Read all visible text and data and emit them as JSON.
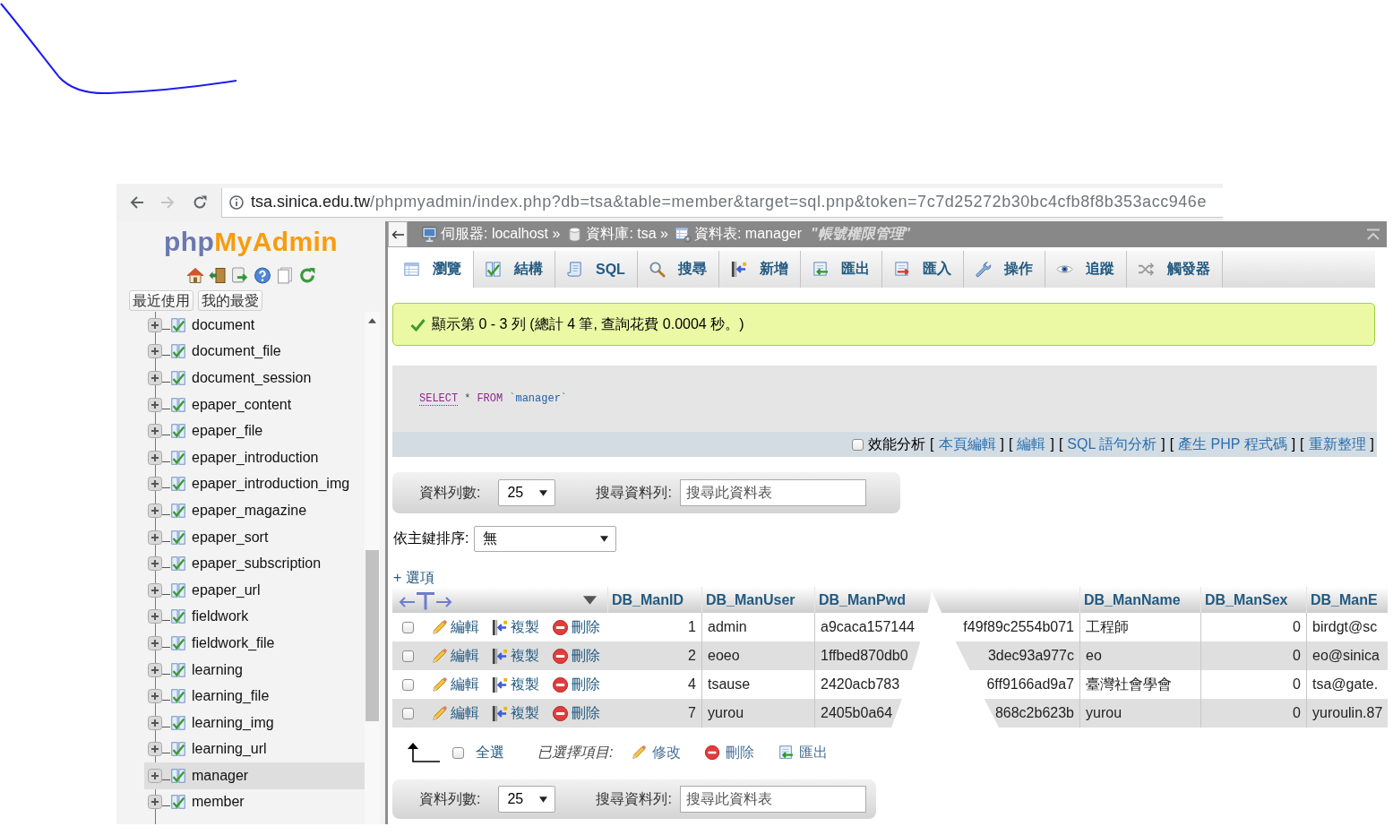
{
  "browser": {
    "url_host": "tsa.sinica.edu.tw",
    "url_path": "/phpmyadmin/index.php?db=tsa&table=member&target=sql.pnp&token=7c7d25272b30bc4cfb8f8b353acc946e"
  },
  "sidebar": {
    "logo": {
      "prefix": "php",
      "name": "MyAdmin"
    },
    "tabs": [
      {
        "label": "最近使用"
      },
      {
        "label": "我的最愛"
      }
    ],
    "tables": [
      {
        "name": "document",
        "expanded": false,
        "selected": false
      },
      {
        "name": "document_file",
        "expanded": false,
        "selected": false
      },
      {
        "name": "document_session",
        "expanded": false,
        "selected": false
      },
      {
        "name": "epaper_content",
        "expanded": false,
        "selected": false
      },
      {
        "name": "epaper_file",
        "expanded": false,
        "selected": false
      },
      {
        "name": "epaper_introduction",
        "expanded": false,
        "selected": false
      },
      {
        "name": "epaper_introduction_img",
        "expanded": false,
        "selected": false
      },
      {
        "name": "epaper_magazine",
        "expanded": false,
        "selected": false
      },
      {
        "name": "epaper_sort",
        "expanded": false,
        "selected": false
      },
      {
        "name": "epaper_subscription",
        "expanded": false,
        "selected": false
      },
      {
        "name": "epaper_url",
        "expanded": false,
        "selected": false
      },
      {
        "name": "fieldwork",
        "expanded": false,
        "selected": false
      },
      {
        "name": "fieldwork_file",
        "expanded": false,
        "selected": false
      },
      {
        "name": "learning",
        "expanded": false,
        "selected": false
      },
      {
        "name": "learning_file",
        "expanded": false,
        "selected": false
      },
      {
        "name": "learning_img",
        "expanded": false,
        "selected": false
      },
      {
        "name": "learning_url",
        "expanded": false,
        "selected": false
      },
      {
        "name": "manager",
        "expanded": false,
        "selected": true
      },
      {
        "name": "member",
        "expanded": false,
        "selected": false
      }
    ]
  },
  "breadcrumb": {
    "items": [
      {
        "kind": "server",
        "label": "伺服器: localhost »"
      },
      {
        "kind": "database",
        "label": "資料庫: tsa »"
      },
      {
        "kind": "table",
        "label": "資料表: manager"
      }
    ],
    "comment": "\"帳號權限管理\""
  },
  "tabs": [
    {
      "kind": "browse",
      "label": "瀏覽",
      "selected": true
    },
    {
      "kind": "structure",
      "label": "結構",
      "selected": false
    },
    {
      "kind": "sql",
      "label": "SQL",
      "selected": false
    },
    {
      "kind": "search",
      "label": "搜尋",
      "selected": false
    },
    {
      "kind": "insert",
      "label": "新增",
      "selected": false
    },
    {
      "kind": "export",
      "label": "匯出",
      "selected": false
    },
    {
      "kind": "import",
      "label": "匯入",
      "selected": false
    },
    {
      "kind": "operations",
      "label": "操作",
      "selected": false
    },
    {
      "kind": "tracking",
      "label": "追蹤",
      "selected": false
    },
    {
      "kind": "triggers",
      "label": "觸發器",
      "selected": false
    }
  ],
  "message": {
    "text": "顯示第 0 - 3 列 (總計 4 筆, 查詢花費 0.0004 秒。)"
  },
  "query": {
    "tokens": [
      {
        "kind": "keyword_link",
        "text": "SELECT"
      },
      {
        "kind": "operator",
        "text": "*"
      },
      {
        "kind": "keyword",
        "text": "FROM"
      },
      {
        "kind": "identifier",
        "text": "`manager`"
      }
    ],
    "profiling": {
      "label": "效能分析",
      "checked": false
    },
    "links": [
      {
        "open": "[",
        "label": "本頁編輯",
        "close": "]"
      },
      {
        "open": "[",
        "label": "編輯",
        "close": "]"
      },
      {
        "open": "[",
        "label": "SQL 語句分析",
        "close": "]"
      },
      {
        "open": "[",
        "label": "產生 PHP 程式碼",
        "close": "]"
      },
      {
        "open": "[",
        "label": "重新整理",
        "close": "]"
      }
    ]
  },
  "navigation_top": {
    "rows_label": "資料列數:",
    "rows_value": "25",
    "search_label": "搜尋資料列:",
    "search_placeholder": "搜尋此資料表"
  },
  "sort": {
    "label": "依主鍵排序:",
    "value": "無"
  },
  "options_link": {
    "label": "+ 選項"
  },
  "table": {
    "columns": [
      {
        "label": "DB_ManID",
        "kind": "number"
      },
      {
        "label": "DB_ManUser",
        "kind": "text"
      },
      {
        "label": "DB_ManPwd",
        "kind": "torn"
      },
      {
        "label": "DB_ManName",
        "kind": "text"
      },
      {
        "label": "DB_ManSex",
        "kind": "number"
      },
      {
        "label": "DB_ManE",
        "kind": "text"
      }
    ],
    "rows": [
      {
        "checked": false,
        "actions": [
          {
            "kind": "edit",
            "label": "編輯"
          },
          {
            "kind": "copy",
            "label": "複製"
          },
          {
            "kind": "delete",
            "label": "刪除"
          }
        ],
        "cells": [
          {
            "text": "1"
          },
          {
            "text": "admin"
          },
          {
            "start": "a9caca157144",
            "end": "f49f89c2554b071"
          },
          {
            "text": "工程師"
          },
          {
            "text": "0"
          },
          {
            "text": "birdgt@sc"
          }
        ]
      },
      {
        "checked": false,
        "actions": [
          {
            "kind": "edit",
            "label": "編輯"
          },
          {
            "kind": "copy",
            "label": "複製"
          },
          {
            "kind": "delete",
            "label": "刪除"
          }
        ],
        "cells": [
          {
            "text": "2"
          },
          {
            "text": "eoeo"
          },
          {
            "start": "1ffbed870db0",
            "end": "3dec93a977c"
          },
          {
            "text": "eo"
          },
          {
            "text": "0"
          },
          {
            "text": "eo@sinica"
          }
        ]
      },
      {
        "checked": false,
        "actions": [
          {
            "kind": "edit",
            "label": "編輯"
          },
          {
            "kind": "copy",
            "label": "複製"
          },
          {
            "kind": "delete",
            "label": "刪除"
          }
        ],
        "cells": [
          {
            "text": "4"
          },
          {
            "text": "tsause"
          },
          {
            "start": "2420acb783",
            "end": "6ff9166ad9a7"
          },
          {
            "text": "臺灣社會學會"
          },
          {
            "text": "0"
          },
          {
            "text": "tsa@gate."
          }
        ]
      },
      {
        "checked": false,
        "actions": [
          {
            "kind": "edit",
            "label": "編輯"
          },
          {
            "kind": "copy",
            "label": "複製"
          },
          {
            "kind": "delete",
            "label": "刪除"
          }
        ],
        "cells": [
          {
            "text": "7"
          },
          {
            "text": "yurou"
          },
          {
            "start": "2405b0a64",
            "end": "868c2b623b"
          },
          {
            "text": "yurou"
          },
          {
            "text": "0"
          },
          {
            "text": "yuroulin.87"
          }
        ]
      }
    ]
  },
  "bulk": {
    "select_all": {
      "label": "全選",
      "checked": false
    },
    "with_selected": "已選擇項目:",
    "actions": [
      {
        "kind": "edit",
        "label": "修改"
      },
      {
        "kind": "delete",
        "label": "刪除"
      },
      {
        "kind": "export",
        "label": "匯出"
      }
    ]
  },
  "navigation_bottom": {
    "rows_label": "資料列數:",
    "rows_value": "25",
    "search_label": "搜尋資料列:",
    "search_placeholder": "搜尋此資料表"
  }
}
